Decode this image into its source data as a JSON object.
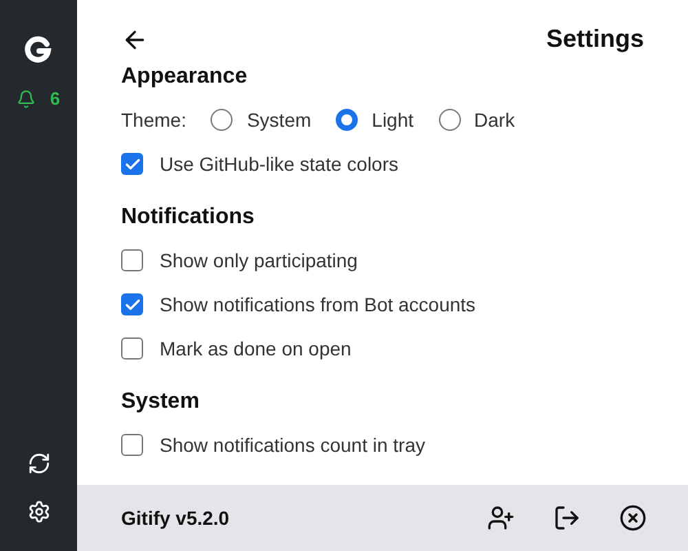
{
  "sidebar": {
    "notification_count": "6"
  },
  "header": {
    "title": "Settings"
  },
  "sections": [
    {
      "title": "Appearance",
      "rows": [
        {
          "kind": "radio",
          "label": "Theme:",
          "options": [
            {
              "label": "System",
              "selected": false
            },
            {
              "label": "Light",
              "selected": true
            },
            {
              "label": "Dark",
              "selected": false
            }
          ]
        },
        {
          "kind": "checkbox",
          "label": "Use GitHub-like state colors",
          "checked": true
        }
      ]
    },
    {
      "title": "Notifications",
      "rows": [
        {
          "kind": "checkbox",
          "label": "Show only participating",
          "checked": false
        },
        {
          "kind": "checkbox",
          "label": "Show notifications from Bot accounts",
          "checked": true
        },
        {
          "kind": "checkbox",
          "label": "Mark as done on open",
          "checked": false
        }
      ]
    },
    {
      "title": "System",
      "rows": [
        {
          "kind": "checkbox",
          "label": "Show notifications count in tray",
          "checked": false
        }
      ]
    }
  ],
  "footer": {
    "version": "Gitify v5.2.0"
  }
}
